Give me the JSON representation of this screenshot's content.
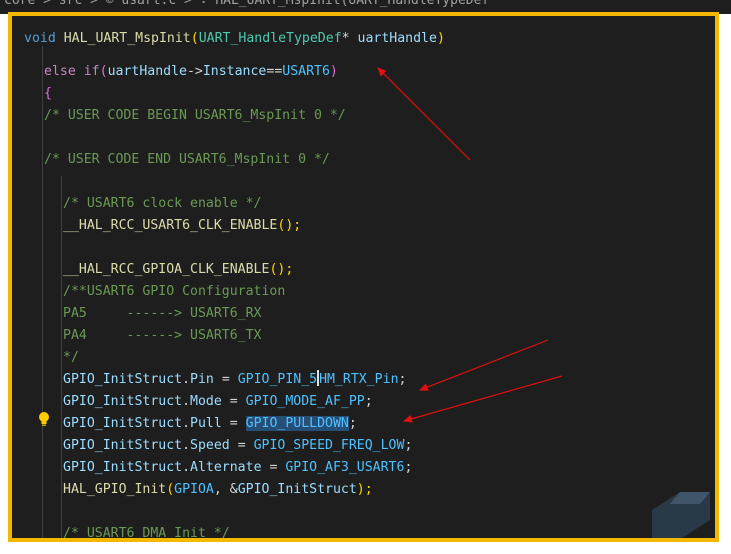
{
  "header_crumb": "core > src > © usart.c > ∵ HAL_UART_MspInit(UART_HandleTypeDef *",
  "code": {
    "line1": {
      "t1": "void",
      "t2": "HAL_UART_MspInit",
      "t3": "(",
      "t4": "UART_HandleTypeDef",
      "t5": "* ",
      "t6": "uartHandle",
      "t7": ")"
    },
    "line2": {
      "t1": "else",
      "t2": "if",
      "t3": "(",
      "t4": "uartHandle",
      "t5": "->",
      "t6": "Instance",
      "t7": "==",
      "t8": "USART6",
      "t9": ")"
    },
    "line3": "{",
    "line4": "/* USER CODE BEGIN USART6_MspInit 0 */",
    "line5": "/* USER CODE END USART6_MspInit 0 */",
    "line6": "/* USART6 clock enable */",
    "line7": {
      "t1": "__HAL_RCC_USART6_CLK_ENABLE",
      "t2": "();"
    },
    "line8": {
      "t1": "__HAL_RCC_GPIOA_CLK_ENABLE",
      "t2": "();"
    },
    "line9": "/**USART6 GPIO Configuration",
    "line10": "PA5     ------> USART6_RX",
    "line11": "PA4     ------> USART6_TX",
    "line12": "*/",
    "line13": {
      "t1": "GPIO_InitStruct",
      "t2": ".",
      "t3": "Pin",
      "t4": " = ",
      "t5": "GPIO_PIN_5",
      "t6": "HM_RTX_Pin",
      "t7": ";"
    },
    "line14": {
      "t1": "GPIO_InitStruct",
      "t2": ".",
      "t3": "Mode",
      "t4": " = ",
      "t5": "GPIO_MODE_AF_PP",
      "t6": ";"
    },
    "line15": {
      "t1": "GPIO_InitStruct",
      "t2": ".",
      "t3": "Pull",
      "t4": " = ",
      "t5": "GPIO_PULLDOWN",
      "t6": ";"
    },
    "line16": {
      "t1": "GPIO_InitStruct",
      "t2": ".",
      "t3": "Speed",
      "t4": " = ",
      "t5": "GPIO_SPEED_FREQ_LOW",
      "t6": ";"
    },
    "line17": {
      "t1": "GPIO_InitStruct",
      "t2": ".",
      "t3": "Alternate",
      "t4": " = ",
      "t5": "GPIO_AF3_USART6",
      "t6": ";"
    },
    "line18": {
      "t1": "HAL_GPIO_Init",
      "t2": "(",
      "t3": "GPIOA",
      "t4": ", &",
      "t5": "GPIO_InitStruct",
      "t6": ");"
    },
    "line19": "/* USART6 DMA Init */"
  },
  "icons": {
    "lightbulb": "lightbulb-icon",
    "annotation": "red-arrow-icon"
  },
  "colors": {
    "frame": "#f5b800",
    "arrow": "#e01010",
    "editor_bg": "#1e1e1e"
  }
}
